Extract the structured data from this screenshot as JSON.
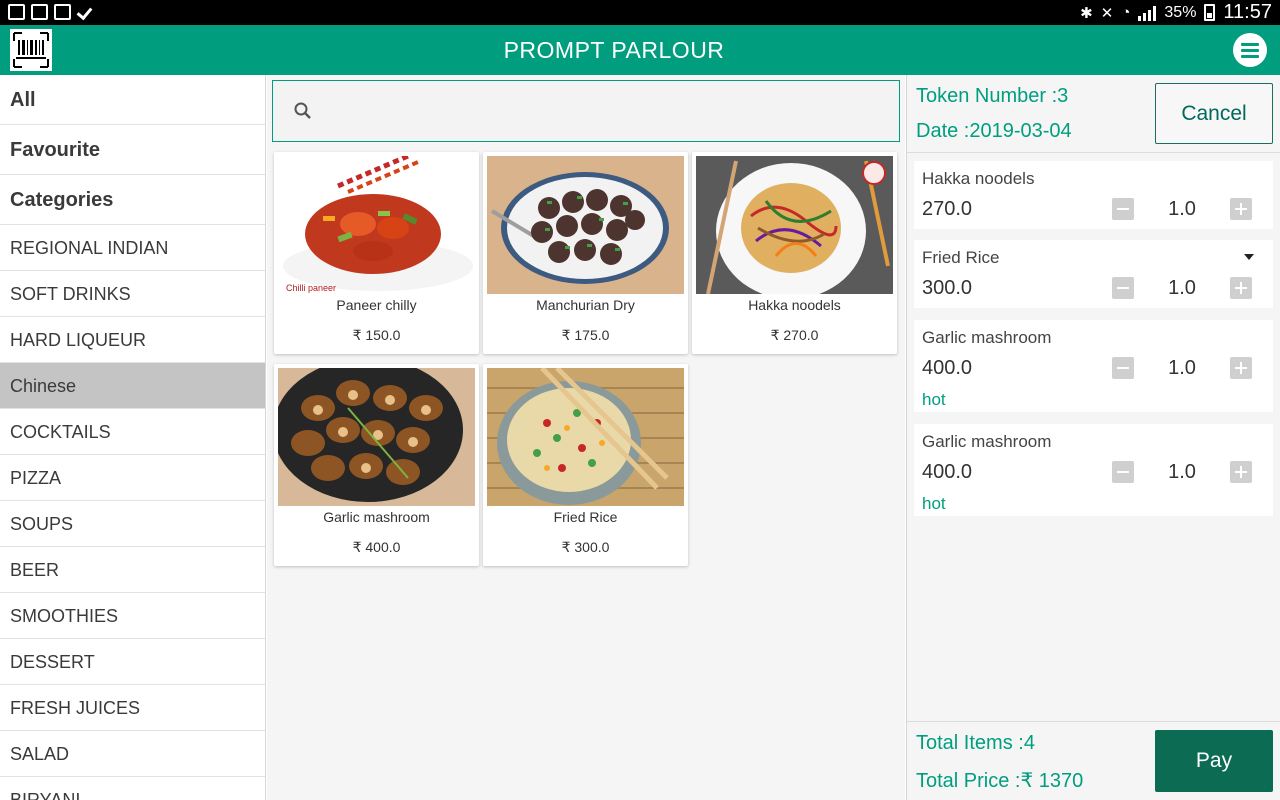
{
  "status_bar": {
    "battery": "35%",
    "time": "11:57"
  },
  "app": {
    "title": "PROMPT PARLOUR",
    "accent_color": "#009e7f"
  },
  "sidebar": {
    "top_items": [
      "All",
      "Favourite",
      "Categories"
    ],
    "categories": [
      "REGIONAL INDIAN",
      "SOFT DRINKS",
      "HARD LIQUEUR",
      "Chinese",
      "COCKTAILS",
      "PIZZA",
      "SOUPS",
      "BEER",
      "SMOOTHIES",
      "DESSERT",
      "FRESH JUICES",
      "SALAD",
      "BIRYANI"
    ],
    "active_category": "Chinese"
  },
  "search": {
    "placeholder": ""
  },
  "products": [
    {
      "name": "Paneer chilly",
      "price": "₹ 150.0",
      "image": "chilli-paneer"
    },
    {
      "name": "Manchurian Dry",
      "price": "₹ 175.0",
      "image": "manchurian"
    },
    {
      "name": "Hakka noodels",
      "price": "₹ 270.0",
      "image": "noodles"
    },
    {
      "name": "Garlic mashroom",
      "price": "₹ 400.0",
      "image": "mushroom"
    },
    {
      "name": "Fried Rice",
      "price": "₹ 300.0",
      "image": "fried-rice"
    }
  ],
  "order": {
    "token": "Token Number :3",
    "date": "Date :2019-03-04",
    "cancel_label": "Cancel",
    "items": [
      {
        "name": "Hakka noodels",
        "price": "270.0",
        "qty": "1.0",
        "note": ""
      },
      {
        "name": "Fried Rice",
        "price": "300.0",
        "qty": "1.0",
        "note": ""
      },
      {
        "name": "Garlic mashroom",
        "price": "400.0",
        "qty": "1.0",
        "note": "hot"
      },
      {
        "name": "Garlic mashroom",
        "price": "400.0",
        "qty": "1.0",
        "note": "hot"
      }
    ],
    "total_items": "Total Items :4",
    "total_price": "Total Price :₹ 1370",
    "pay_label": "Pay"
  }
}
